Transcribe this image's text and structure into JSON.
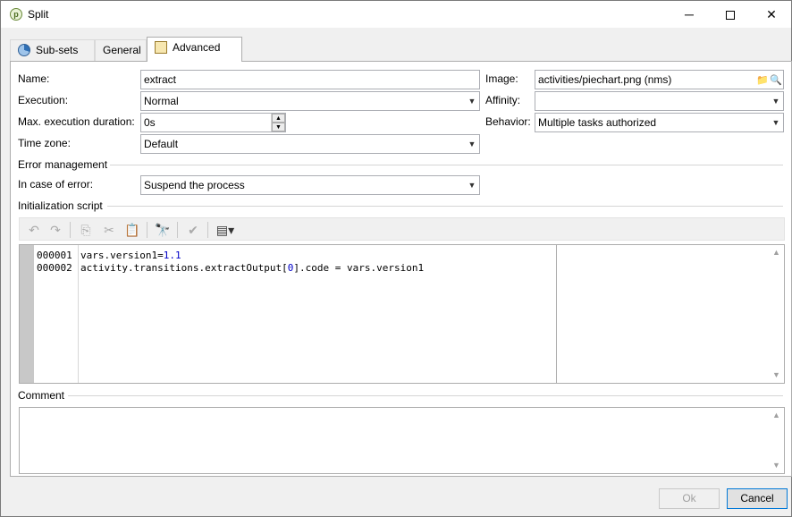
{
  "window": {
    "title": "Split",
    "app_icon": "adobe-campaign-icon",
    "controls": {
      "minimize": "─",
      "maximize": "□",
      "close": "✕"
    }
  },
  "tabs": [
    {
      "label": "Sub-sets",
      "icon": "piechart-icon"
    },
    {
      "label": "General",
      "icon": ""
    },
    {
      "label": "Advanced",
      "icon": "advanced-icon",
      "selected": true
    }
  ],
  "form": {
    "name_label": "Name:",
    "name_value": "extract",
    "execution_label": "Execution:",
    "execution_value": "Normal",
    "max_duration_label": "Max. execution duration:",
    "max_duration_value": "0s",
    "timezone_label": "Time zone:",
    "timezone_value": "Default",
    "image_label": "Image:",
    "image_value": "activities/piechart.png (nms)",
    "affinity_label": "Affinity:",
    "affinity_value": "",
    "behavior_label": "Behavior:",
    "behavior_value": "Multiple tasks authorized"
  },
  "error_section": {
    "title": "Error management",
    "on_error_label": "In case of error:",
    "on_error_value": "Suspend the process"
  },
  "script_section": {
    "title": "Initialization script",
    "lines": [
      {
        "number": "000001",
        "code_pre": "vars.version1=",
        "code_num": "1.1",
        "code_post": ""
      },
      {
        "number": "000002",
        "code_pre": "activity.transitions.extractOutput[",
        "code_num": "0",
        "code_post": "].code = vars.version1"
      }
    ]
  },
  "comment_section": {
    "title": "Comment",
    "value": ""
  },
  "buttons": {
    "ok_label": "Ok",
    "cancel_label": "Cancel"
  }
}
